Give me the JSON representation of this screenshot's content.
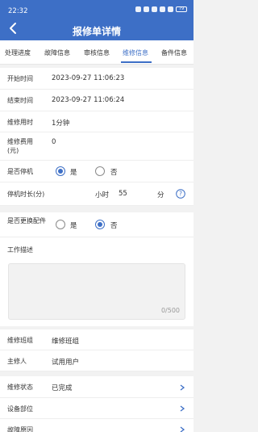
{
  "status_bar": {
    "time": "22:32",
    "battery": "79"
  },
  "header": {
    "title": "报修单详情"
  },
  "tabs": [
    "处理进度",
    "故障信息",
    "审核信息",
    "维修信息",
    "备件信息"
  ],
  "active_tab": "维修信息",
  "fields": {
    "start_time": {
      "label": "开始时间",
      "value": "2023-09-27 11:06:23"
    },
    "end_time": {
      "label": "结束时间",
      "value": "2023-09-27 11:06:24"
    },
    "repair_duration": {
      "label": "维修用时",
      "value": "1分钟"
    },
    "repair_cost": {
      "label": "维修费用(元)",
      "value": "0"
    },
    "downtime": {
      "label": "是否停机",
      "yes": "是",
      "no": "否",
      "selected": "yes"
    },
    "downtime_length": {
      "label": "停机时长(分)",
      "hours_label": "小时",
      "minutes_value": "55",
      "minutes_label": "分"
    },
    "part_replacement": {
      "label": "是否更换配件",
      "yes": "是",
      "no": "否",
      "selected": "no"
    },
    "work_description": {
      "label": "工作描述",
      "counter": "0/500"
    },
    "repair_team": {
      "label": "维修班组",
      "value": "维修班组"
    },
    "lead_repairer": {
      "label": "主修人",
      "value": "试用用户"
    },
    "repair_status": {
      "label": "维修状态",
      "value": "已完成"
    },
    "equipment_part": {
      "label": "设备部位",
      "value": ""
    },
    "fault_cause": {
      "label": "故障原因",
      "value": ""
    }
  },
  "colors": {
    "primary": "#3d6fc6",
    "background": "#f2f2f2"
  }
}
